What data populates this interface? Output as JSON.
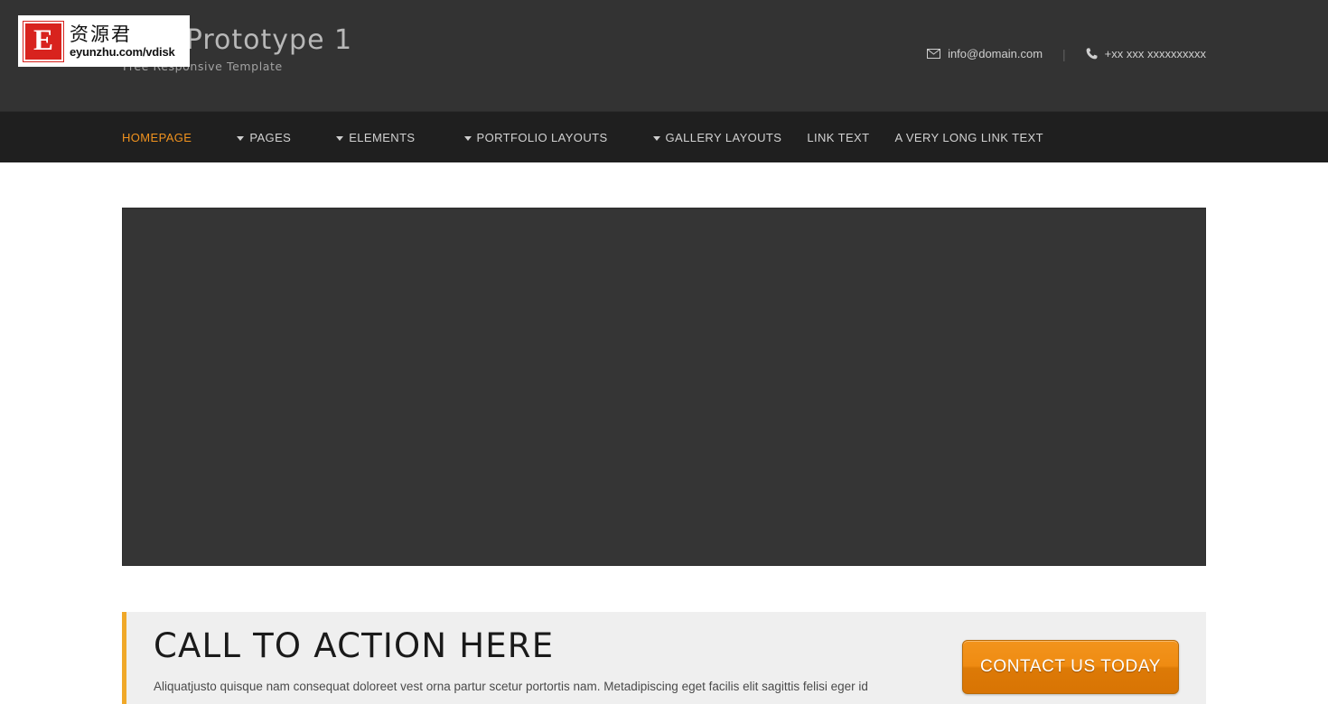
{
  "header": {
    "brand": {
      "title": "200 Prototype 1",
      "tagline": "Free Responsive Template"
    },
    "contact": {
      "email_icon": "envelope-icon",
      "email": "info@domain.com",
      "separator": "|",
      "phone_icon": "phone-icon",
      "phone": "+xx xxx xxxxxxxxxx"
    }
  },
  "nav": {
    "items": [
      {
        "label": "HOMEPAGE",
        "has_caret": false,
        "active": true
      },
      {
        "label": "PAGES",
        "has_caret": true,
        "active": false
      },
      {
        "label": "ELEMENTS",
        "has_caret": true,
        "active": false
      },
      {
        "label": "PORTFOLIO LAYOUTS",
        "has_caret": true,
        "active": false
      },
      {
        "label": "GALLERY LAYOUTS",
        "has_caret": true,
        "active": false
      },
      {
        "label": "LINK TEXT",
        "has_caret": false,
        "active": false
      },
      {
        "label": "A VERY LONG LINK TEXT",
        "has_caret": false,
        "active": false
      }
    ]
  },
  "slider": {
    "alt": "slider-placeholder"
  },
  "cta": {
    "heading": "CALL TO ACTION HERE",
    "body": "Aliquatjusto quisque nam consequat doloreet vest orna partur scetur portortis nam. Metadipiscing eget facilis elit sagittis felisi eger id",
    "button_label": "CONTACT US TODAY"
  },
  "watermark": {
    "badge_letter": "E",
    "chinese": "资源君",
    "url": "eyunzhu.com/vdisk"
  },
  "colors": {
    "header_bg": "#333333",
    "nav_bg": "#1f1f1f",
    "accent_orange": "#f0921e",
    "cta_bg": "#efefef",
    "cta_accent": "#f0a829",
    "slider_bg": "#353535",
    "watermark_red": "#d8231e"
  }
}
